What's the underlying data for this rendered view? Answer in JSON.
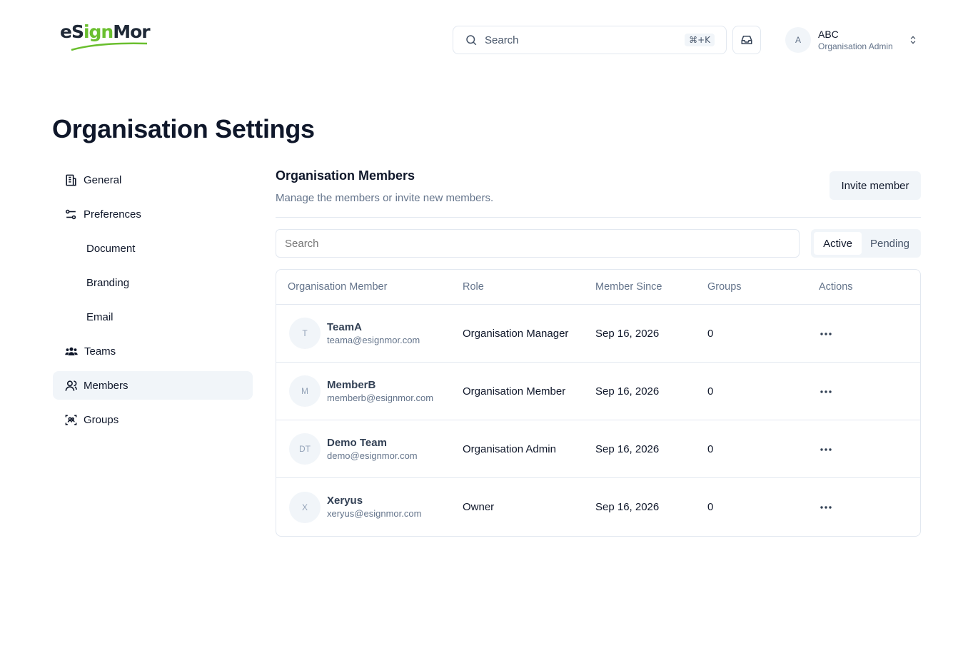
{
  "header": {
    "logo": {
      "part1": "eS",
      "part2": "ign",
      "part3": "Mor"
    },
    "search": {
      "placeholder": "Search",
      "shortcut": "⌘+K"
    },
    "inbox_icon": "inbox-icon",
    "user": {
      "initial": "A",
      "name": "ABC",
      "role": "Organisation Admin"
    }
  },
  "page": {
    "title": "Organisation Settings"
  },
  "sidebar": {
    "items": [
      {
        "label": "General",
        "icon": "building-icon"
      },
      {
        "label": "Preferences",
        "icon": "settings-sliders-icon"
      },
      {
        "label": "Document"
      },
      {
        "label": "Branding"
      },
      {
        "label": "Email"
      },
      {
        "label": "Teams",
        "icon": "users-icon"
      },
      {
        "label": "Members",
        "icon": "user-icon",
        "active": true
      },
      {
        "label": "Groups",
        "icon": "group-scan-icon"
      }
    ]
  },
  "main": {
    "title": "Organisation Members",
    "description": "Manage the members or invite new members.",
    "invite_label": "Invite member",
    "search_placeholder": "Search",
    "tabs": [
      "Active",
      "Pending"
    ],
    "active_tab": "Active",
    "table": {
      "headers": [
        "Organisation Member",
        "Role",
        "Member Since",
        "Groups",
        "Actions"
      ],
      "rows": [
        {
          "initials": "T",
          "name": "TeamA",
          "email": "teama@esignmor.com",
          "role": "Organisation Manager",
          "since": "Sep 16, 2026",
          "groups": "0"
        },
        {
          "initials": "M",
          "name": "MemberB",
          "email": "memberb@esignmor.com",
          "role": "Organisation Member",
          "since": "Sep 16, 2026",
          "groups": "0"
        },
        {
          "initials": "DT",
          "name": "Demo Team",
          "email": "demo@esignmor.com",
          "role": "Organisation Admin",
          "since": "Sep 16, 2026",
          "groups": "0"
        },
        {
          "initials": "X",
          "name": "Xeryus",
          "email": "xeryus@esignmor.com",
          "role": "Owner",
          "since": "Sep 16, 2026",
          "groups": "0"
        }
      ]
    }
  },
  "colors": {
    "accent_green": "#6abf2e",
    "muted_bg": "#f1f5f9",
    "border": "#e2e8f0"
  }
}
